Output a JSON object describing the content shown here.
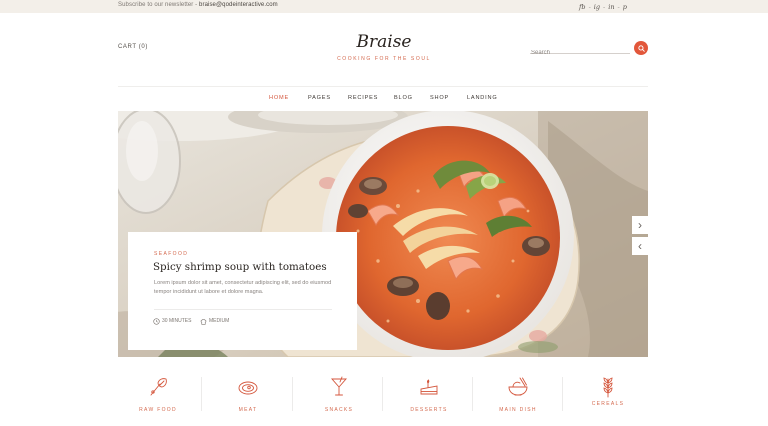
{
  "topbar": {
    "newsletter_prefix": "Subscribe to our newsletter - ",
    "newsletter_email": "braise@qodeinteractive.com",
    "social": [
      {
        "label": "fb",
        "icon": "facebook-icon"
      },
      {
        "label": "ig",
        "icon": "instagram-icon"
      },
      {
        "label": "in",
        "icon": "linkedin-icon"
      },
      {
        "label": "p",
        "icon": "pinterest-icon"
      }
    ],
    "social_separator": "-"
  },
  "header": {
    "cart_label": "CART (0)",
    "logo": "Braise",
    "tagline": "COOKING FOR THE SOUL",
    "search_placeholder": "Search"
  },
  "nav": {
    "items": [
      {
        "label": "HOME",
        "active": true
      },
      {
        "label": "PAGES",
        "active": false
      },
      {
        "label": "RECIPES",
        "active": false
      },
      {
        "label": "BLOG",
        "active": false
      },
      {
        "label": "SHOP",
        "active": false
      },
      {
        "label": "LANDING",
        "active": false
      }
    ]
  },
  "hero": {
    "category": "SEAFOOD",
    "title": "Spicy shrimp soup with tomatoes",
    "excerpt": "Lorem ipsum dolor sit amet, consectetur adipiscing elit, sed do eiusmod tempor incididunt ut labore et dolore magna.",
    "time": "30 MINUTES",
    "difficulty": "MEDIUM",
    "next_arrow": "›",
    "prev_arrow": "‹"
  },
  "categories": [
    {
      "label": "RAW FOOD",
      "icon": "raw-food-icon"
    },
    {
      "label": "MEAT",
      "icon": "meat-icon"
    },
    {
      "label": "SNACKS",
      "icon": "cocktail-icon"
    },
    {
      "label": "DESSERTS",
      "icon": "cake-icon"
    },
    {
      "label": "MAIN DISH",
      "icon": "bowl-icon"
    },
    {
      "label": "CEREALS",
      "icon": "wheat-icon"
    }
  ],
  "colors": {
    "accent": "#e2573b",
    "accent_text": "#d46a4f",
    "topbar_bg": "#f3efe9",
    "heading": "#2b2622"
  }
}
